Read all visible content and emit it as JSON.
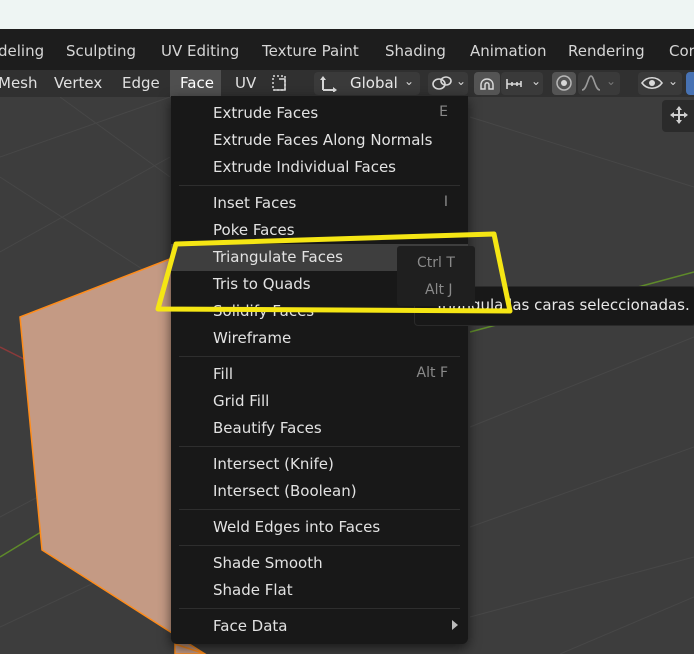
{
  "workspace_tabs": [
    "deling",
    "Sculpting",
    "UV Editing",
    "Texture Paint",
    "Shading",
    "Animation",
    "Rendering",
    "Cor"
  ],
  "header": {
    "mesh": "Mesh",
    "vertex": "Vertex",
    "edge": "Edge",
    "face": "Face",
    "uv": "UV",
    "transform_orientation": "Global"
  },
  "face_menu": {
    "items": [
      {
        "label": "Extrude Faces",
        "shortcut": "E"
      },
      {
        "label": "Extrude Faces Along Normals",
        "shortcut": ""
      },
      {
        "label": "Extrude Individual Faces",
        "shortcut": ""
      },
      {
        "label": "Inset Faces",
        "shortcut": "I"
      },
      {
        "label": "Poke Faces",
        "shortcut": ""
      },
      {
        "label": "Triangulate Faces",
        "shortcut": "Ctrl T"
      },
      {
        "label": "Tris to Quads",
        "shortcut": "Alt J"
      },
      {
        "label": "Solidify Faces",
        "shortcut": ""
      },
      {
        "label": "Wireframe",
        "shortcut": ""
      },
      {
        "label": "Fill",
        "shortcut": "Alt F"
      },
      {
        "label": "Grid Fill",
        "shortcut": ""
      },
      {
        "label": "Beautify Faces",
        "shortcut": ""
      },
      {
        "label": "Intersect (Knife)",
        "shortcut": ""
      },
      {
        "label": "Intersect (Boolean)",
        "shortcut": ""
      },
      {
        "label": "Weld Edges into Faces",
        "shortcut": ""
      },
      {
        "label": "Shade Smooth",
        "shortcut": ""
      },
      {
        "label": "Shade Flat",
        "shortcut": ""
      },
      {
        "label": "Face Data",
        "shortcut": ""
      }
    ],
    "highlighted": "Triangulate Faces"
  },
  "tooltip": {
    "text": "Triangula las caras seleccionadas."
  },
  "colors": {
    "annotation": "#f5e614",
    "mesh_face": "#c49a84",
    "mesh_edge": "#ff8c1a",
    "menu_bg": "#181818"
  },
  "icons": [
    "cursor-select-icon",
    "link-icon",
    "snap-icon",
    "snap-increment-icon",
    "proportional-edit-icon",
    "falloff-icon",
    "visibility-icon",
    "transform-tool-icon"
  ]
}
